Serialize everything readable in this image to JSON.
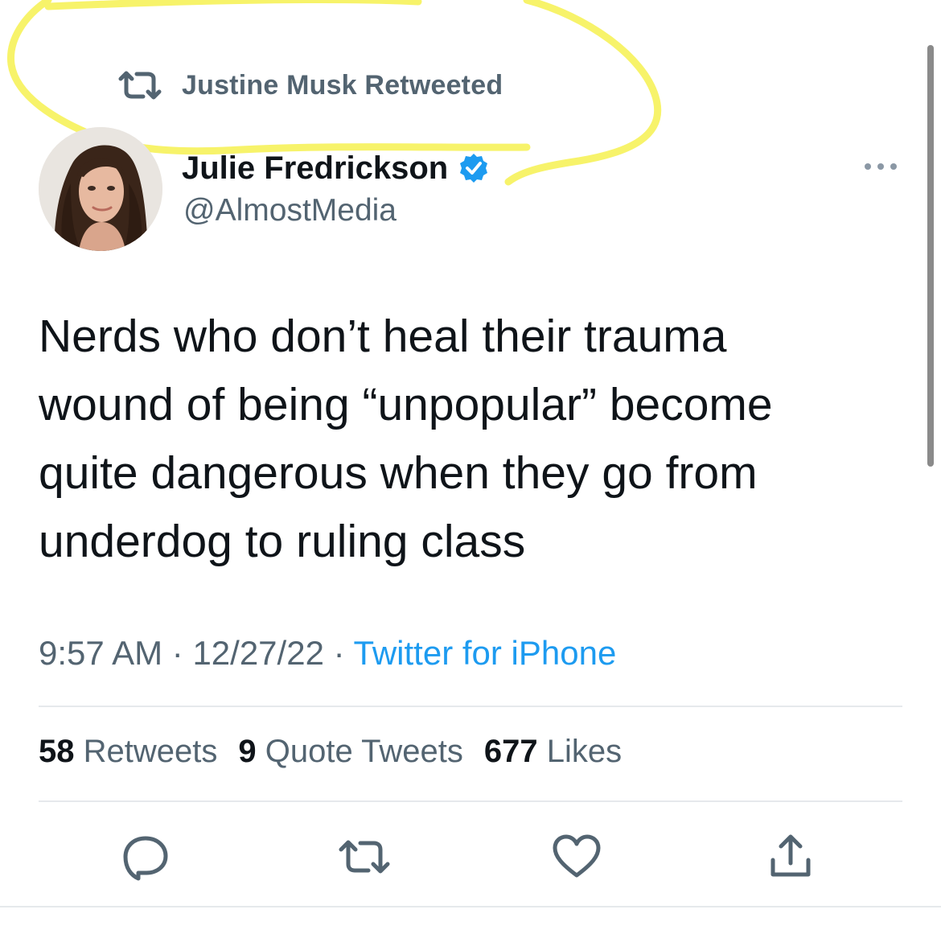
{
  "retweet_context": {
    "icon": "retweet-icon",
    "text": "Justine Musk Retweeted"
  },
  "author": {
    "name": "Julie Fredrickson",
    "handle": "@AlmostMedia",
    "verified": true,
    "avatar": "avatar-photo"
  },
  "tweet": {
    "text": "Nerds who don’t heal their trauma\nwound of being “unpopular” become\nquite dangerous when they go from\nunderdog to ruling class"
  },
  "meta": {
    "time": "9:57 AM",
    "date": "12/27/22",
    "separator": " · ",
    "source": "Twitter for iPhone"
  },
  "stats": {
    "retweets": {
      "count": "58",
      "label": "Retweets"
    },
    "quotes": {
      "count": "9",
      "label": "Quote Tweets"
    },
    "likes": {
      "count": "677",
      "label": "Likes"
    }
  },
  "actions": [
    "reply-icon",
    "retweet-icon",
    "like-icon",
    "share-icon"
  ],
  "colors": {
    "text_primary": "#0f1419",
    "text_secondary": "#536471",
    "accent": "#1d9bf0",
    "highlight": "#f7f36a",
    "divider": "#e6e9ec"
  }
}
